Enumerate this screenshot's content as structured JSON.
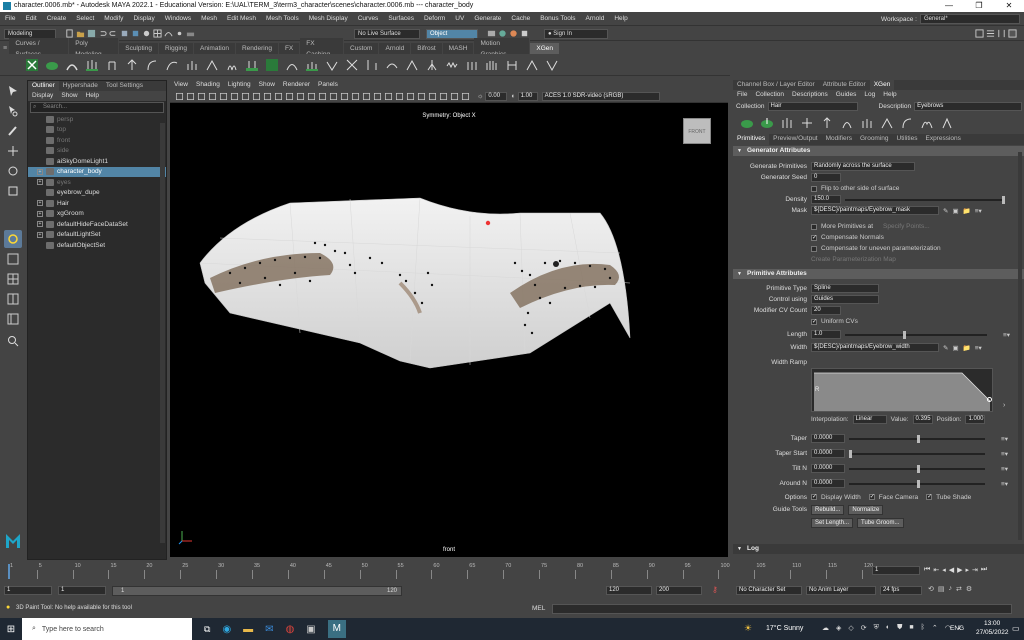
{
  "titlebar": {
    "title": "character.0006.mb* - Autodesk MAYA 2022.1 - Educational Version: E:\\UAL\\TERM_3\\term3_character\\scenes\\character.0006.mb  ---  character_body",
    "minimize": "—",
    "maximize": "❐",
    "close": "✕"
  },
  "menubar": {
    "items": [
      "File",
      "Edit",
      "Create",
      "Select",
      "Modify",
      "Display",
      "Windows",
      "Mesh",
      "Edit Mesh",
      "Mesh Tools",
      "Mesh Display",
      "Curves",
      "Surfaces",
      "Deform",
      "UV",
      "Generate",
      "Cache",
      "Bonus Tools",
      "Arnold",
      "Help"
    ],
    "workspace_label": "Workspace :",
    "workspace_value": "General*"
  },
  "statusline": {
    "mode": "Modeling",
    "live_surface": "No Live Surface",
    "object_mode": "Object",
    "sign_in": "Sign In"
  },
  "shelf": {
    "tabs": [
      "Curves / Surfaces",
      "Poly Modeling",
      "Sculpting",
      "Rigging",
      "Animation",
      "Rendering",
      "FX",
      "FX Caching",
      "Custom",
      "Arnold",
      "Bifrost",
      "MASH",
      "Motion Graphics",
      "XGen"
    ],
    "active_tab": "XGen"
  },
  "outliner": {
    "tabs": [
      "Outliner",
      "Hypershade",
      "Tool Settings"
    ],
    "menu": [
      "Display",
      "Show",
      "Help"
    ],
    "search_placeholder": "Search...",
    "items": [
      {
        "label": "persp",
        "dim": true,
        "expand": false
      },
      {
        "label": "top",
        "dim": true,
        "expand": false
      },
      {
        "label": "front",
        "dim": true,
        "expand": false
      },
      {
        "label": "side",
        "dim": true,
        "expand": false
      },
      {
        "label": "aiSkyDomeLight1",
        "dim": false,
        "expand": false
      },
      {
        "label": "character_body",
        "dim": false,
        "expand": true,
        "selected": true
      },
      {
        "label": "eyes",
        "dim": true,
        "expand": true
      },
      {
        "label": "eyebrow_dupe",
        "dim": false,
        "expand": false
      },
      {
        "label": "Hair",
        "dim": false,
        "expand": true
      },
      {
        "label": "xgGroom",
        "dim": false,
        "expand": true
      },
      {
        "label": "defaultHideFaceDataSet",
        "dim": false,
        "expand": true
      },
      {
        "label": "defaultLightSet",
        "dim": false,
        "expand": true
      },
      {
        "label": "defaultObjectSet",
        "dim": false,
        "expand": false
      }
    ]
  },
  "viewport": {
    "menu": [
      "View",
      "Shading",
      "Lighting",
      "Show",
      "Renderer",
      "Panels"
    ],
    "exposure": "0.00",
    "gamma": "1.00",
    "color_space": "ACES 1.0 SDR-video (sRGB)",
    "symmetry": "Symmetry: Object X",
    "camera_label": "front",
    "cube_label": "FRONT"
  },
  "rightpanel": {
    "top_tabs": [
      "Channel Box / Layer Editor",
      "Attribute Editor",
      "XGen"
    ],
    "menu": [
      "File",
      "Collection",
      "Descriptions",
      "Guides",
      "Log",
      "Help"
    ],
    "collection_label": "Collection",
    "collection_value": "Hair",
    "description_label": "Description",
    "description_value": "Eyebrows",
    "sub_tabs": [
      "Primitives",
      "Preview/Output",
      "Modifiers",
      "Grooming",
      "Utilities",
      "Expressions"
    ],
    "gen_section": "Generator Attributes",
    "generate_primitives_label": "Generate Primitives",
    "generate_primitives_value": "Randomly across the surface",
    "generator_seed_label": "Generator Seed",
    "generator_seed_value": "0",
    "flip_label": "Flip to other side of surface",
    "density_label": "Density",
    "density_value": "150.0",
    "density_level": 1.0,
    "mask_label": "Mask",
    "mask_value": "${DESC}/paintmaps/Eyebrow_mask",
    "more_prims_label": "More Primitives at",
    "specify_points": "Specify Points...",
    "compensate_normals": "Compensate Normals",
    "compensate_param": "Compensate for uneven parameterization",
    "create_param_map": "Create Parameterization Map",
    "prim_section": "Primitive Attributes",
    "primitive_type_label": "Primitive Type",
    "primitive_type_value": "Spline",
    "control_using_label": "Control using",
    "control_using_value": "Guides",
    "modifier_cv_label": "Modifier CV Count",
    "modifier_cv_value": "20",
    "uniform_cvs": "Uniform CVs",
    "length_label": "Length",
    "length_value": "1.0",
    "width_label": "Width",
    "width_value": "${DESC}/paintmaps/Eyebrow_width",
    "width_ramp_label": "Width Ramp",
    "interp_label": "Interpolation:",
    "interp_value": "Linear",
    "ramp_value_label": "Value:",
    "ramp_value": "0.395",
    "ramp_pos_label": "Position:",
    "ramp_pos": "1.000",
    "taper_label": "Taper",
    "taper_value": "0.0000",
    "taper_start_label": "Taper Start",
    "taper_start_value": "0.0000",
    "tilt_n_label": "Tilt N",
    "tilt_n_value": "0.0000",
    "around_n_label": "Around N",
    "around_n_value": "0.0000",
    "options_label": "Options",
    "display_width": "Display Width",
    "face_camera": "Face Camera",
    "tube_shade": "Tube Shade",
    "guide_tools_label": "Guide Tools",
    "rebuild": "Rebuild...",
    "normalize": "Normalize",
    "set_length": "Set Length...",
    "tube_groom": "Tube Groom...",
    "log_section": "Log"
  },
  "timeline": {
    "ticks": [
      "1",
      "5",
      "10",
      "15",
      "20",
      "25",
      "30",
      "35",
      "40",
      "45",
      "50",
      "55",
      "60",
      "65",
      "70",
      "75",
      "80",
      "85",
      "90",
      "95",
      "100",
      "105",
      "110",
      "115",
      "120"
    ],
    "current_frame": "1"
  },
  "rangebar": {
    "start": "1",
    "inner_start": "1",
    "range_start_box": "1",
    "range_end_box": "120",
    "end": "120",
    "max_end": "200",
    "character_set": "No Character Set",
    "anim_layer": "No Anim Layer",
    "fps": "24 fps"
  },
  "cmdline": {
    "help_text": "3D Paint Tool: No help available for this tool",
    "mel": "MEL"
  },
  "taskbar": {
    "search_placeholder": "Type here to search",
    "weather": "17°C  Sunny",
    "lang": "ENG",
    "time": "13:00",
    "date": "27/05/2022"
  }
}
